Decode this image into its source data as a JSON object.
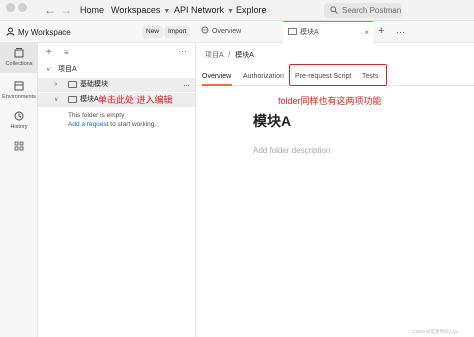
{
  "topbar": {
    "home": "Home",
    "workspaces": "Workspaces",
    "api_network": "API Network",
    "explore": "Explore",
    "search_placeholder": "Search Postman"
  },
  "workspace": {
    "title": "My Workspace",
    "new_label": "New",
    "import_label": "Import"
  },
  "rail": {
    "items": [
      {
        "label": "Collections",
        "icon": "collections-icon"
      },
      {
        "label": "Environments",
        "icon": "environments-icon"
      },
      {
        "label": "History",
        "icon": "history-icon"
      },
      {
        "label": "",
        "icon": "apps-icon"
      }
    ]
  },
  "tree": {
    "collection": "项目A",
    "folder1": "基础模块",
    "folder2": "模块A",
    "empty_text": "This folder is empty",
    "add_request_link": "Add a request",
    "add_request_suffix": " to start working."
  },
  "tabs": {
    "overview": "Overview",
    "active": "模块A"
  },
  "main": {
    "breadcrumb_parent": "项目A",
    "breadcrumb_sep": "/",
    "breadcrumb_current": "模块A",
    "subtabs": [
      "Overview",
      "Authorization",
      "Pre-request Script",
      "Tests"
    ],
    "title": "模块A",
    "description_placeholder": "Add folder description"
  },
  "annotations": {
    "left": "单击此处 进入编辑",
    "right": "folder同样也有这两项功能"
  },
  "watermark": "CSDN @是星时间入gv",
  "colors": {
    "accent": "#f26b3a",
    "annotation": "#e02020",
    "link": "#1a5fd3"
  }
}
